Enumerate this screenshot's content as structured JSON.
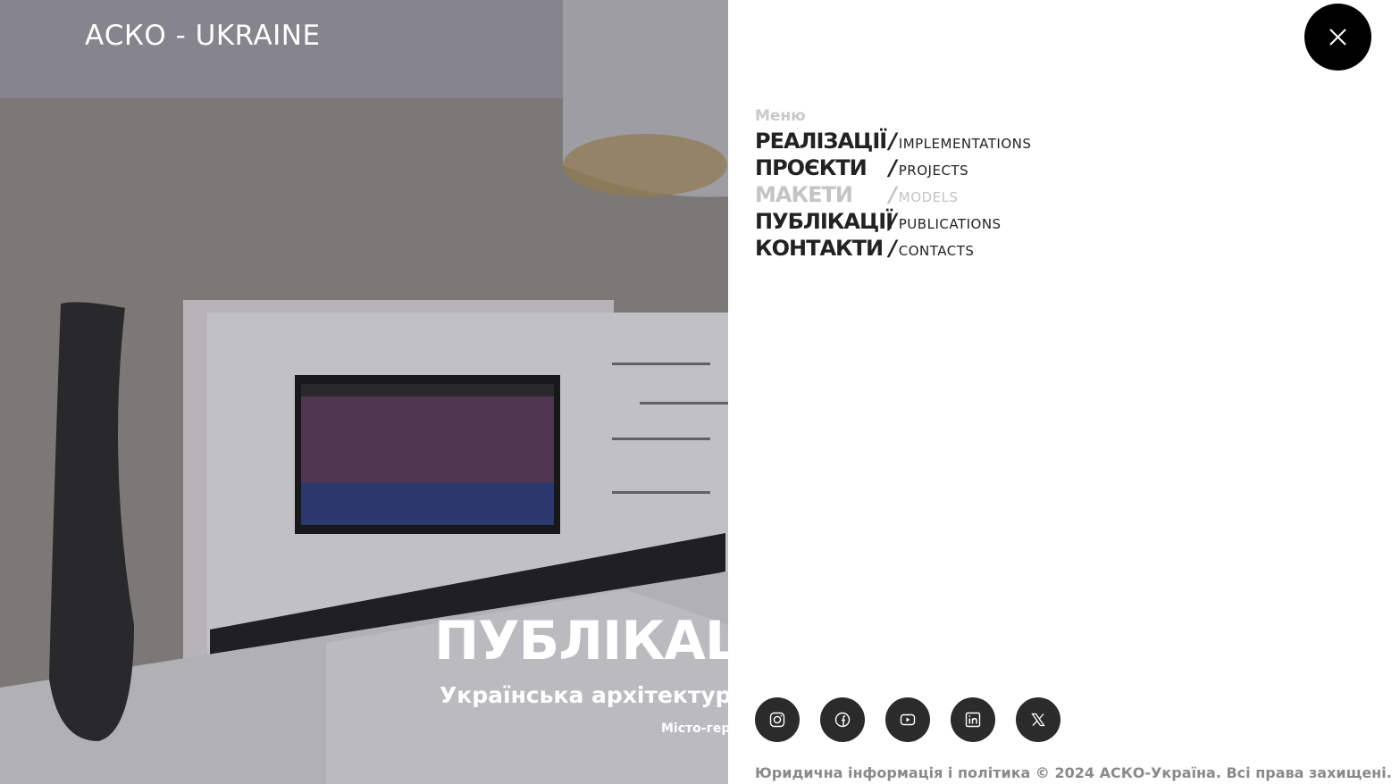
{
  "brand": {
    "name": "АСКО - UKRAINE"
  },
  "hero": {
    "title": "ПУБЛІКАЦІЇ",
    "subtitle": "Українська архітектурна",
    "caption": "Місто-герой"
  },
  "close": {
    "icon": "close-icon"
  },
  "menu": {
    "heading": "Меню",
    "items": [
      {
        "ua": "РЕАЛІЗАЦІЇ",
        "en": "IMPLEMENTATIONS",
        "muted": false
      },
      {
        "ua": "ПРОЄКТИ",
        "en": "PROJECTS",
        "muted": false
      },
      {
        "ua": "МАКЕТИ",
        "en": "MODELS",
        "muted": true
      },
      {
        "ua": "ПУБЛІКАЦІЇ",
        "en": "PUBLICATIONS",
        "muted": false
      },
      {
        "ua": "КОНТАКТИ",
        "en": "CONTACTS",
        "muted": false
      }
    ],
    "slash": "/"
  },
  "socials": [
    {
      "icon": "instagram-icon"
    },
    {
      "icon": "facebook-icon"
    },
    {
      "icon": "youtube-icon"
    },
    {
      "icon": "linkedin-icon"
    },
    {
      "icon": "x-twitter-icon"
    }
  ],
  "footer": {
    "text": "Юридична інформація і політика © 2024 АСКО-Україна. Всі права захищені."
  },
  "colors": {
    "panel_bg": "#ffffff",
    "text_dark": "#222222",
    "text_muted": "#c4c4c4",
    "social_bg": "#2b2b2b",
    "close_bg": "#000000"
  }
}
